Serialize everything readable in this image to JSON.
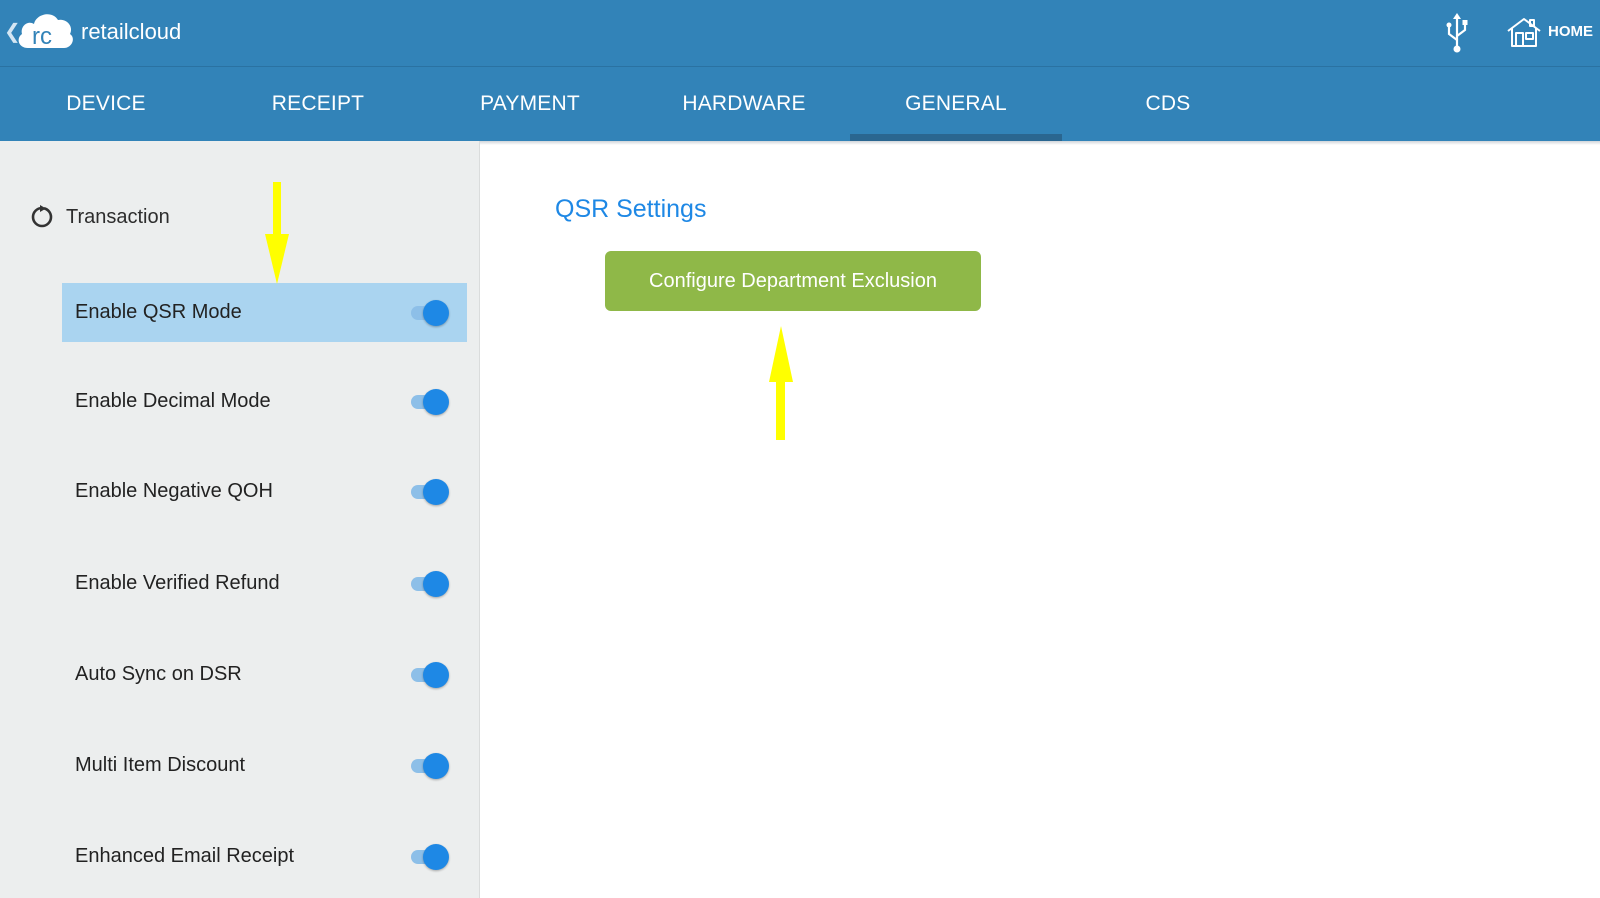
{
  "header": {
    "app_title": "retailcloud",
    "logo_text": "rc",
    "home_label": "HOME",
    "back_icon": "chevron-left-icon",
    "usb_icon": "usb-icon",
    "home_icon": "house-icon"
  },
  "tabs": [
    {
      "label": "DEVICE",
      "active": false
    },
    {
      "label": "RECEIPT",
      "active": false
    },
    {
      "label": "PAYMENT",
      "active": false
    },
    {
      "label": "HARDWARE",
      "active": false
    },
    {
      "label": "GENERAL",
      "active": true
    },
    {
      "label": "CDS",
      "active": false
    }
  ],
  "sidebar": {
    "section": {
      "label": "Transaction",
      "icon": "sync-icon"
    },
    "settings": [
      {
        "label": "Enable QSR Mode",
        "enabled": true,
        "selected": true
      },
      {
        "label": "Enable Decimal Mode",
        "enabled": true,
        "selected": false
      },
      {
        "label": "Enable Negative QOH",
        "enabled": true,
        "selected": false
      },
      {
        "label": "Enable Verified Refund",
        "enabled": true,
        "selected": false
      },
      {
        "label": "Auto Sync on DSR",
        "enabled": true,
        "selected": false
      },
      {
        "label": "Multi Item Discount",
        "enabled": true,
        "selected": false
      },
      {
        "label": "Enhanced Email Receipt",
        "enabled": true,
        "selected": false
      }
    ]
  },
  "main": {
    "section_title": "QSR Settings",
    "config_button_label": "Configure Department Exclusion"
  },
  "colors": {
    "header_bg": "#3283b8",
    "accent_blue": "#1e88e5",
    "selected_row": "#aad4f0",
    "button_green": "#8fb848",
    "annotation_arrow": "#ffff00"
  }
}
